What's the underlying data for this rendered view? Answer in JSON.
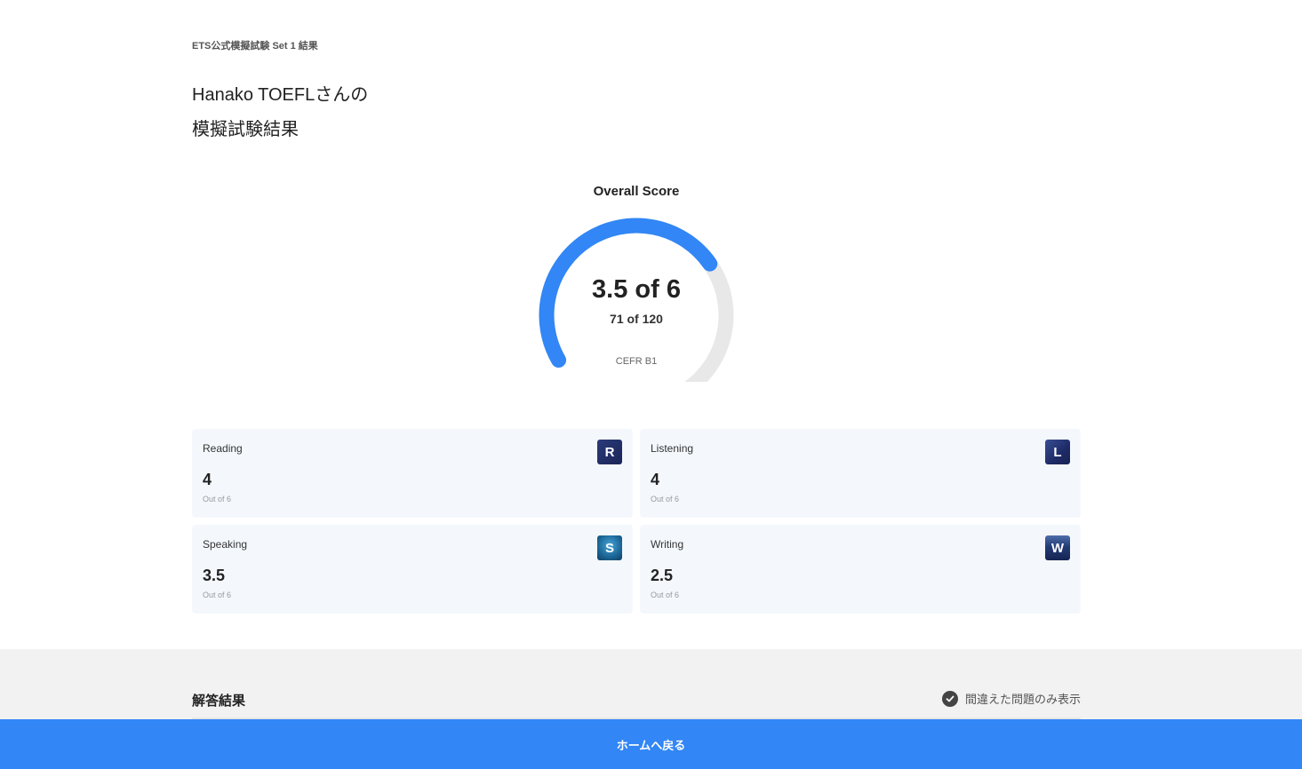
{
  "breadcrumb": "ETS公式模擬試験 Set 1 結果",
  "title": {
    "line1": "Hanako TOEFLさんの",
    "line2": "模擬試験結果"
  },
  "overall": {
    "heading": "Overall Score",
    "score_text": "3.5 of 6",
    "score_value": 3.5,
    "score_max": 6,
    "sub_text": "71 of 120",
    "cefr": "CEFR B1",
    "colors": {
      "fill": "#3286f5",
      "track": "#e8e8e8"
    }
  },
  "sections": [
    {
      "label": "Reading",
      "score": "4",
      "out_of": "Out of 6",
      "icon_letter": "R",
      "icon": "reading-icon"
    },
    {
      "label": "Listening",
      "score": "4",
      "out_of": "Out of 6",
      "icon_letter": "L",
      "icon": "listening-icon"
    },
    {
      "label": "Speaking",
      "score": "3.5",
      "out_of": "Out of 6",
      "icon_letter": "S",
      "icon": "speaking-icon"
    },
    {
      "label": "Writing",
      "score": "2.5",
      "out_of": "Out of 6",
      "icon_letter": "W",
      "icon": "writing-icon"
    }
  ],
  "answers": {
    "title": "解答結果",
    "filter_label": "間違えた問題のみ表示",
    "filter_icon": "check-circle-icon"
  },
  "home_button": "ホームへ戻る",
  "colors": {
    "accent": "#3286f5",
    "card_bg": "#f4f8fd",
    "lower_bg": "#f2f2f2"
  }
}
